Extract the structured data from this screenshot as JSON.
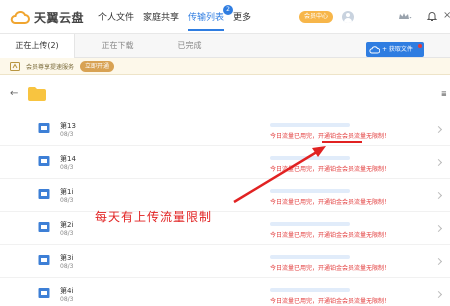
{
  "app": {
    "logo_text": "天翼云盘",
    "logo_icon": "cloud-logo-icon"
  },
  "nav": {
    "items": [
      {
        "label": "个人文件",
        "active": false
      },
      {
        "label": "家庭共享",
        "active": false
      },
      {
        "label": "传输列表",
        "active": true,
        "badge": "2"
      },
      {
        "label": "更多",
        "active": false
      }
    ],
    "vip_label": "会员中心",
    "close_glyph": "×"
  },
  "subtabs": [
    {
      "label": "正在上传(2)",
      "active": true
    },
    {
      "label": "正在下载",
      "active": false
    },
    {
      "label": "已完成",
      "active": false
    }
  ],
  "get_file_button": {
    "label": "+ 获取文件"
  },
  "promo": {
    "text": "会员尊享提速服务",
    "button": "立即开通"
  },
  "pathbar": {
    "back_glyph": "←",
    "right_glyph": "≣"
  },
  "files": [
    {
      "name": "第13",
      "date": "08/3",
      "message": "今日流量已用完，开通铂金会员流量无限制！"
    },
    {
      "name": "第14",
      "date": "08/3",
      "message": "今日流量已用完，开通铂金会员流量无限制！"
    },
    {
      "name": "第1i",
      "date": "08/3",
      "message": "今日流量已用完，开通铂金会员流量无限制！"
    },
    {
      "name": "第2i",
      "date": "08/3",
      "message": "今日流量已用完，开通铂金会员流量无限制！"
    },
    {
      "name": "第3i",
      "date": "08/3",
      "message": "今日流量已用完，开通铂金会员流量无限制！"
    },
    {
      "name": "第4i",
      "date": "08/3",
      "message": "今日流量已用完，开通铂金会员流量无限制！"
    }
  ],
  "annotation": {
    "text": "每天有上传流量限制",
    "color": "#e12222"
  },
  "colors": {
    "accent": "#2f7de1",
    "warning": "#e23b3b",
    "vip": "#f7b64a"
  }
}
